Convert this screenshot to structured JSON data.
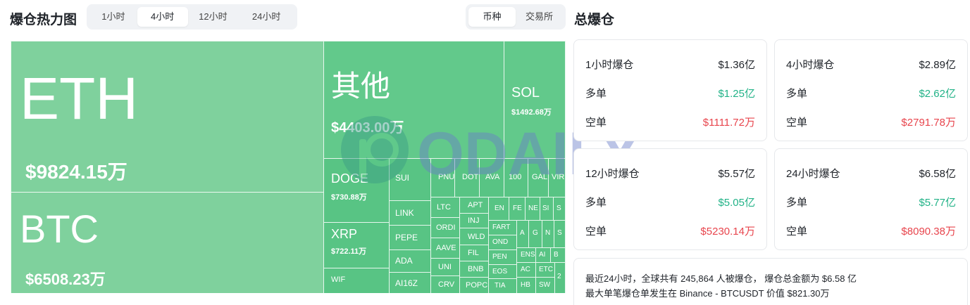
{
  "heatmap": {
    "title": "爆仓热力图"
  },
  "time_tabs": [
    "1小时",
    "4小时",
    "12小时",
    "24小时"
  ],
  "time_active": 1,
  "group_tabs": [
    "币种",
    "交易所"
  ],
  "group_active": 0,
  "treemap": {
    "eth": {
      "name": "ETH",
      "value": "$9824.15万"
    },
    "btc": {
      "name": "BTC",
      "value": "$6508.23万"
    },
    "other": {
      "name": "其他",
      "value": "$4403.00万"
    },
    "sol": {
      "name": "SOL",
      "value": "$1492.68万"
    },
    "doge": {
      "name": "DOGE",
      "value": "$730.88万"
    },
    "xrp": {
      "name": "XRP",
      "value": "$722.11万"
    },
    "small": [
      "SUI",
      "LINK",
      "PEPE",
      "ADA",
      "AI16Z",
      "WIF",
      "PNU",
      "DOT",
      "AVA",
      "100",
      "GAL",
      "VIR",
      "LTC",
      "APT",
      "ORDI",
      "INJ",
      "WLD",
      "AAVE",
      "FIL",
      "UNI",
      "BNB",
      "CRV",
      "POPC",
      "EN",
      "FE",
      "NE",
      "SI",
      "S",
      "FART",
      "A",
      "G",
      "N",
      "S",
      "OND",
      "PEN",
      "ENS",
      "AI",
      "B",
      "EOS",
      "AC",
      "ETC",
      "TIA",
      "HB",
      "SW",
      "2"
    ]
  },
  "total": {
    "title": "总爆仓"
  },
  "cards": [
    {
      "period": "1小时爆仓",
      "total": "$1.36亿",
      "long_label": "多单",
      "long": "$1.25亿",
      "short_label": "空单",
      "short": "$1111.72万"
    },
    {
      "period": "4小时爆仓",
      "total": "$2.89亿",
      "long_label": "多单",
      "long": "$2.62亿",
      "short_label": "空单",
      "short": "$2791.78万"
    },
    {
      "period": "12小时爆仓",
      "total": "$5.57亿",
      "long_label": "多单",
      "long": "$5.05亿",
      "short_label": "空单",
      "short": "$5230.14万"
    },
    {
      "period": "24小时爆仓",
      "total": "$6.58亿",
      "long_label": "多单",
      "long": "$5.77亿",
      "short_label": "空单",
      "short": "$8090.38万"
    }
  ],
  "summary": {
    "line1": "最近24小时，全球共有 245,864 人被爆仓，  爆仓总金额为 $6.58 亿",
    "line2": "最大单笔爆仓单发生在 Binance - BTCUSDT 价值 $821.30万"
  },
  "watermark": {
    "text": "ODAILY"
  },
  "colors": {
    "long": "#21b287",
    "short": "#e8454d",
    "treemap": "#5ec98c"
  }
}
